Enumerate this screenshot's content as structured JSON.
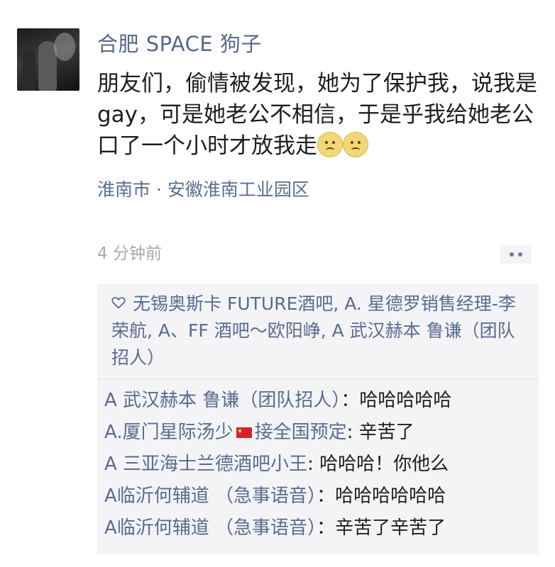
{
  "post": {
    "username": "合肥 SPACE 狗子",
    "text": "朋友们，偷情被发现，她为了保护我，说我是gay，可是她老公不相信，于是乎我给她老公口了一个小时才放我走",
    "location": "淮南市 · 安徽淮南工业园区",
    "time": "4 分钟前"
  },
  "likes": {
    "text": "无锡奥斯卡 FUTURE酒吧, A. 星德罗销售经理-李荣航, A、FF 酒吧～欧阳峥, A 武汉赫本 鲁谦（团队招人）"
  },
  "comments": [
    {
      "name": "A 武汉赫本 鲁谦（团队招人）",
      "sep": "：",
      "text": "哈哈哈哈哈"
    },
    {
      "name": "A.厦门星际汤少",
      "name_suffix": "接全国预定",
      "sep": ": ",
      "text": "辛苦了"
    },
    {
      "name": "A 三亚海士兰德酒吧小王",
      "sep": ": ",
      "text": "哈哈哈！你他么"
    },
    {
      "name": "A临沂何辅道 （急事语音）",
      "sep": "：",
      "text": "哈哈哈哈哈哈"
    },
    {
      "name": "A临沂何辅道 （急事语音）",
      "sep": "：",
      "text": "辛苦了辛苦了"
    }
  ],
  "icons": {
    "emoji": "sad-face-emoji",
    "like": "heart-outline-icon",
    "more": "more-dots-icon",
    "flag": "china-flag-icon"
  },
  "colors": {
    "name_link": "#576b93",
    "time": "#a9a9a9",
    "comment_bg": "#f4f4f6"
  }
}
